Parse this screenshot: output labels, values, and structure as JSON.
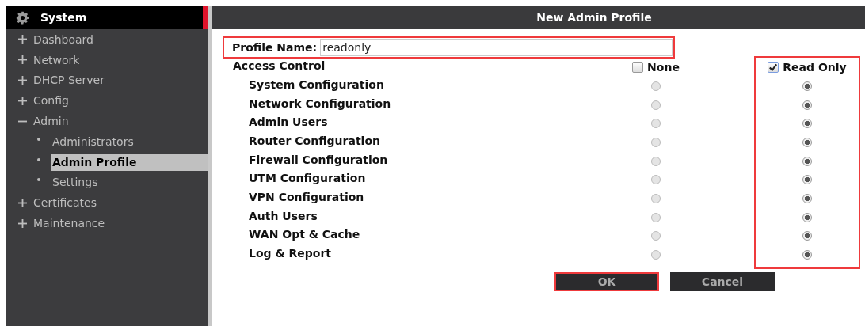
{
  "sidebar": {
    "title": "System",
    "items": [
      {
        "label": "Dashboard",
        "expanded": false
      },
      {
        "label": "Network",
        "expanded": false
      },
      {
        "label": "DHCP Server",
        "expanded": false
      },
      {
        "label": "Config",
        "expanded": false
      },
      {
        "label": "Admin",
        "expanded": true,
        "children": [
          {
            "label": "Administrators",
            "selected": false
          },
          {
            "label": "Admin Profile",
            "selected": true
          },
          {
            "label": "Settings",
            "selected": false
          }
        ]
      },
      {
        "label": "Certificates",
        "expanded": false
      },
      {
        "label": "Maintenance",
        "expanded": false
      }
    ]
  },
  "panel": {
    "title": "New Admin Profile",
    "profile_name": {
      "label": "Profile Name:",
      "value": "readonly",
      "highlighted": true
    },
    "access_control": {
      "label": "Access Control",
      "columns": [
        {
          "label": "None",
          "checked": false,
          "highlighted": false
        },
        {
          "label": "Read Only",
          "checked": true,
          "highlighted": true
        }
      ],
      "rows": [
        {
          "label": "System Configuration",
          "choices": [
            {
              "selected": false
            },
            {
              "selected": true
            }
          ]
        },
        {
          "label": "Network Configuration",
          "choices": [
            {
              "selected": false
            },
            {
              "selected": true
            }
          ]
        },
        {
          "label": "Admin Users",
          "choices": [
            {
              "selected": false
            },
            {
              "selected": true
            }
          ]
        },
        {
          "label": "Router Configuration",
          "choices": [
            {
              "selected": false
            },
            {
              "selected": true
            }
          ]
        },
        {
          "label": "Firewall Configuration",
          "choices": [
            {
              "selected": false
            },
            {
              "selected": true
            }
          ]
        },
        {
          "label": "UTM Configuration",
          "choices": [
            {
              "selected": false
            },
            {
              "selected": true
            }
          ]
        },
        {
          "label": "VPN Configuration",
          "choices": [
            {
              "selected": false
            },
            {
              "selected": true
            }
          ]
        },
        {
          "label": "Auth Users",
          "choices": [
            {
              "selected": false
            },
            {
              "selected": true
            }
          ]
        },
        {
          "label": "WAN Opt & Cache",
          "choices": [
            {
              "selected": false
            },
            {
              "selected": true
            }
          ]
        },
        {
          "label": "Log & Report",
          "choices": [
            {
              "selected": false
            },
            {
              "selected": true
            }
          ]
        }
      ]
    },
    "buttons": [
      {
        "label": "OK",
        "highlighted": true
      },
      {
        "label": "Cancel",
        "highlighted": false
      }
    ]
  }
}
